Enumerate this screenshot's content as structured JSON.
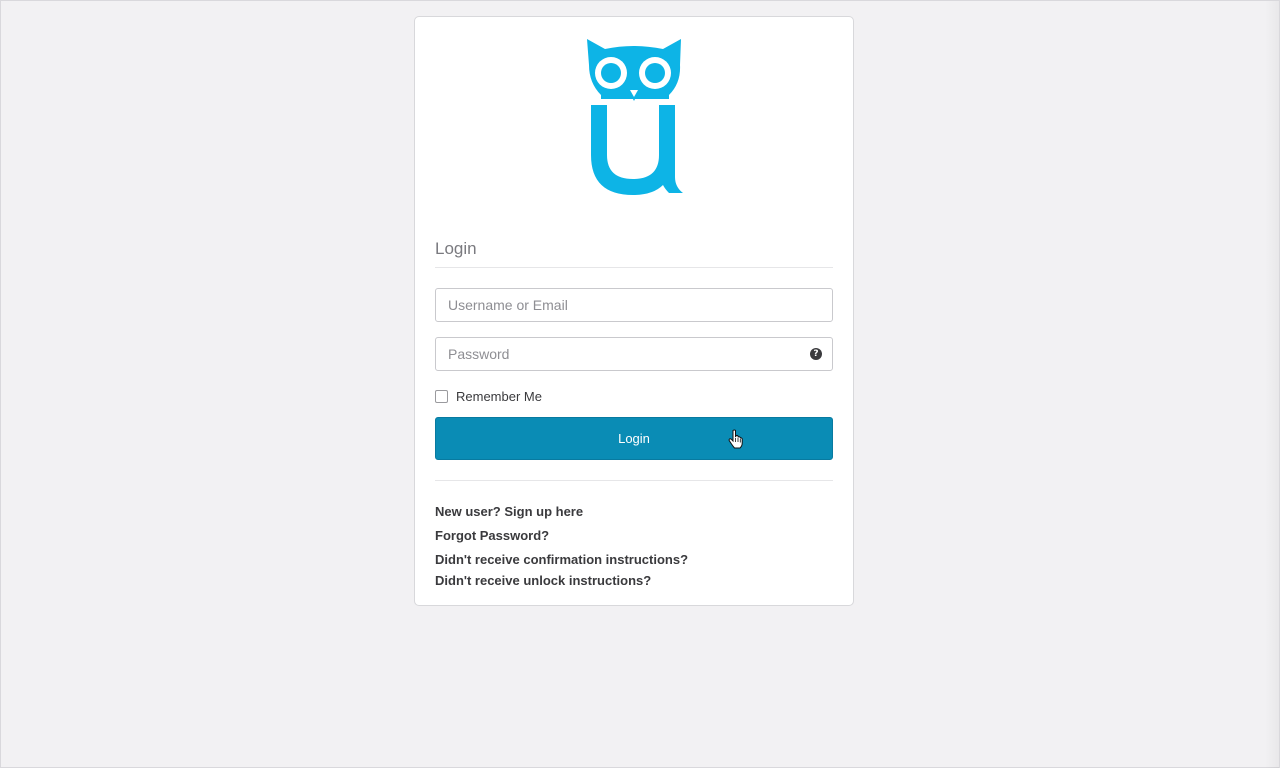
{
  "colors": {
    "background": "#f2f1f3",
    "brand": "#0db4e6",
    "button": "#0a8cb5"
  },
  "logo": {
    "icon": "owl-u-logo"
  },
  "form": {
    "title": "Login",
    "username_placeholder": "Username or Email",
    "password_placeholder": "Password",
    "help_glyph": "?",
    "remember_label": "Remember Me",
    "remember_checked": false,
    "submit_label": "Login"
  },
  "links": [
    "New user? Sign up here",
    "Forgot Password?",
    "Didn't receive confirmation instructions?",
    "Didn't receive unlock instructions?"
  ]
}
